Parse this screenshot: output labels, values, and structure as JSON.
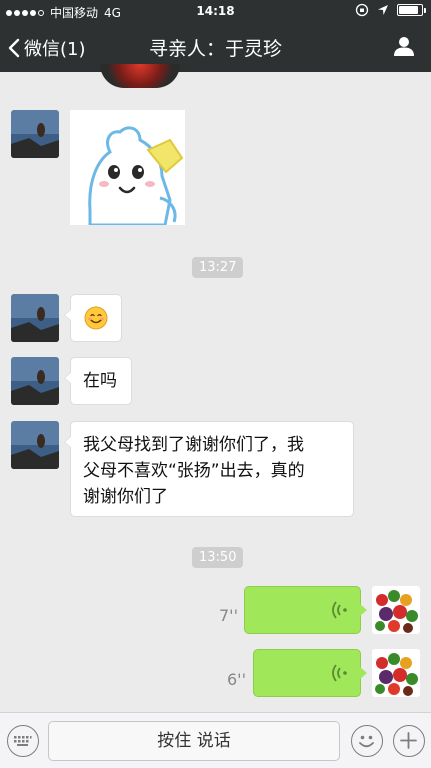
{
  "status_bar": {
    "carrier": "中国移动",
    "network": "4G",
    "time": "14:18"
  },
  "nav": {
    "back_label": "微信(1)",
    "title": "寻亲人：于灵珍"
  },
  "messages": [
    {
      "type": "sticker",
      "from": "other",
      "icon": "cartoon-sticker"
    },
    {
      "type": "time",
      "text": "13:27"
    },
    {
      "type": "emoji",
      "from": "other",
      "icon": "smile-emoji"
    },
    {
      "type": "text",
      "from": "other",
      "text": "在吗"
    },
    {
      "type": "text",
      "from": "other",
      "lines": [
        "我父母找到了谢谢你们了，我",
        "父母不喜欢“张扬”出去，真的",
        "谢谢你们了"
      ]
    },
    {
      "type": "time",
      "text": "13:50"
    },
    {
      "type": "voice",
      "from": "me",
      "duration": "7''"
    },
    {
      "type": "voice",
      "from": "me",
      "duration": "6''"
    }
  ],
  "input_bar": {
    "hold_to_talk_label": "按住 说话"
  },
  "colors": {
    "nav_bg": "#2e3132",
    "chat_bg": "#ebebeb",
    "voice_bubble": "#a0e75a"
  }
}
